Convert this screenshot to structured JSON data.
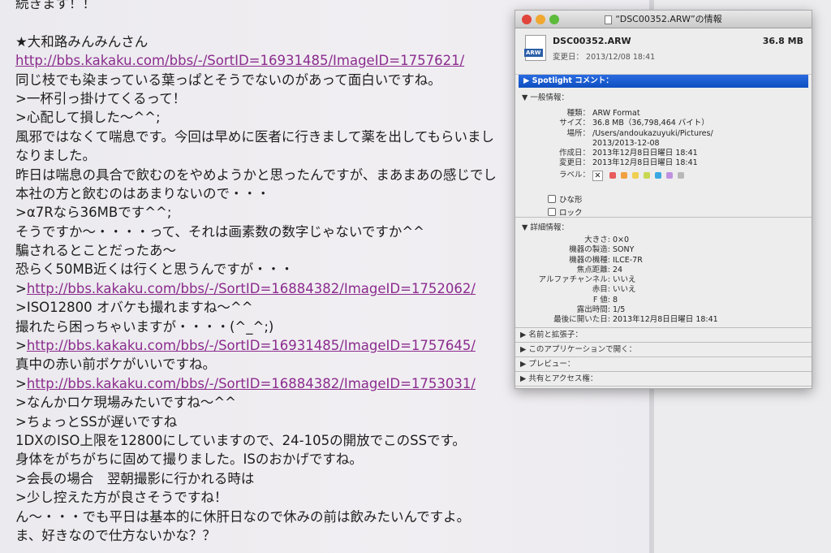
{
  "post": {
    "lines": [
      {
        "text": "続きます！！"
      },
      {
        "text": ""
      },
      {
        "text": "★大和路みんみんさん"
      },
      {
        "link": "http://bbs.kakaku.com/bbs/-/SortID=16931485/ImageID=1757621/"
      },
      {
        "text": "同じ枝でも染まっている葉っぱとそうでないのがあって面白いですね。"
      },
      {
        "text": " >一杯引っ掛けてくるって！"
      },
      {
        "text": " >心配して損した～^^;"
      },
      {
        "text": "風邪ではなくて喘息です。今回は早めに医者に行きまして薬を出してもらいまし"
      },
      {
        "text": "なりました。"
      },
      {
        "text": "昨日は喘息の具合で飲むのをやめようかと思ったんですが、まあまあの感じでし"
      },
      {
        "text": "本社の方と飲むのはあまりないので・・・"
      },
      {
        "text": " >α7Rなら36MBです^^;"
      },
      {
        "text": " そうですか～・・・・って、それは画素数の数字じゃないですか^^"
      },
      {
        "text": " 騙されるとことだったあ～"
      },
      {
        "text": " 恐らく50MB近くは行くと思うんですが・・・"
      },
      {
        "prefix": " >",
        "link": "http://bbs.kakaku.com/bbs/-/SortID=16884382/ImageID=1752062/"
      },
      {
        "text": " >ISO12800 オバケも撮れますね～^^"
      },
      {
        "text": " 撮れたら困っちゃいますが・・・・(^_^;)"
      },
      {
        "prefix": " >",
        "link": "http://bbs.kakaku.com/bbs/-/SortID=16931485/ImageID=1757645/"
      },
      {
        "text": " 真中の赤い前ボケがいいですね。"
      },
      {
        "prefix": " >",
        "link": "http://bbs.kakaku.com/bbs/-/SortID=16884382/ImageID=1753031/"
      },
      {
        "text": " >なんかロケ現場みたいですね～^^"
      },
      {
        "text": " >ちょっとSSが遅いですね"
      },
      {
        "text": " 1DXのISO上限を12800にしていますので、24-105の開放でこのSSです。"
      },
      {
        "text": " 身体をがちがちに固めて撮りました。ISのおかげですね。"
      },
      {
        "text": " >会長の場合　翌朝撮影に行かれる時は"
      },
      {
        "text": " >少し控えた方が良さそうですね！"
      },
      {
        "text": " ん～・・・でも平日は基本的に休肝日なので休みの前は飲みたいんですよ。"
      },
      {
        "text": " ま、好きなので仕方ないかな？？"
      }
    ]
  },
  "info": {
    "title": "“DSC00352.ARW”の情報",
    "icon_badge": "ARW",
    "filename": "DSC00352.ARW",
    "size": "36.8 MB",
    "modified_label": "変更日：",
    "modified": "2013/12/08 18:41",
    "spotlight": "Spotlight コメント：",
    "general": {
      "header": "一般情報：",
      "rows": [
        {
          "k": "種類：",
          "v": "ARW Format"
        },
        {
          "k": "サイズ：",
          "v": "36.8 MB（36,798,464 バイト）"
        },
        {
          "k": "場所：",
          "v": "/Users/andoukazuyuki/Pictures/"
        },
        {
          "k": "",
          "v": "2013/2013-12-08"
        },
        {
          "k": "作成日：",
          "v": "2013年12月8日日曜日 18:41"
        },
        {
          "k": "変更日：",
          "v": "2013年12月8日日曜日 18:41"
        }
      ],
      "label_key": "ラベル：",
      "label_none": "✕",
      "label_colors": [
        "#e85c5c",
        "#f0a040",
        "#f0d050",
        "#c8d850",
        "#3aa8e0",
        "#c090e0",
        "#b8b8b8"
      ],
      "stationery": "ひな形",
      "locked": "ロック"
    },
    "details": {
      "header": "詳細情報：",
      "rows": [
        {
          "k": "大きさ:",
          "v": "0×0"
        },
        {
          "k": "機器の製造:",
          "v": "SONY"
        },
        {
          "k": "機器の機種:",
          "v": "ILCE-7R"
        },
        {
          "k": "焦点距離:",
          "v": "24"
        },
        {
          "k": "アルファチャンネル:",
          "v": "いいえ"
        },
        {
          "k": "赤目:",
          "v": "いいえ"
        },
        {
          "k": "F 値:",
          "v": "8"
        },
        {
          "k": "露出時間:",
          "v": "1/5"
        },
        {
          "k": "最後に開いた日:",
          "v": "2013年12月8日日曜日 18:41"
        }
      ]
    },
    "collapsed": [
      "名前と拡張子：",
      "このアプリケーションで開く：",
      "プレビュー：",
      "共有とアクセス権："
    ]
  }
}
